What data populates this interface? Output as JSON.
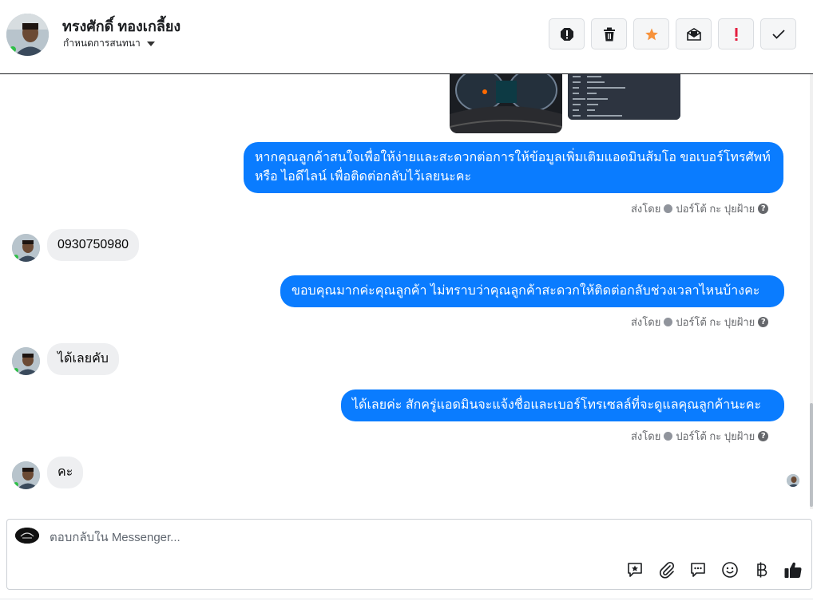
{
  "header": {
    "contact_name": "ทรงศักดิ์ ทองเกลี้ยง",
    "assign_label": "กำหนดการสนทนา",
    "toolbar": [
      {
        "icon": "stop-icon",
        "color": "#1c1e21"
      },
      {
        "icon": "trash-icon",
        "color": "#1c1e21"
      },
      {
        "icon": "star-icon",
        "color": "#f7923b"
      },
      {
        "icon": "mark-unread-icon",
        "color": "#1c1e21"
      },
      {
        "icon": "exclamation-icon",
        "color": "#e41e3f"
      },
      {
        "icon": "check-icon",
        "color": "#1c1e21"
      }
    ]
  },
  "thread": {
    "messages": [
      {
        "direction": "out",
        "text": "หากคุณลูกค้าสนใจเพื่อให้ง่ายและสะดวกต่อการให้ข้อมูลเพิ่มเติมแอดมินส้มโอ ขอเบอร์โทรศัพท์ หรือ ไอดีไลน์ เพื่อติดต่อกลับไว้เลยนะคะ",
        "sent_by_label": "ส่งโดย",
        "sender": "ปอร์โต้ กะ ปุยฝ้าย"
      },
      {
        "direction": "in",
        "text": "0930750980"
      },
      {
        "direction": "out",
        "text": "ขอบคุณมากค่ะคุณลูกค้า ไม่ทราบว่าคุณลูกค้าสะดวกให้ติดต่อกลับช่วงเวลาไหนบ้างคะ",
        "sent_by_label": "ส่งโดย",
        "sender": "ปอร์โต้ กะ ปุยฝ้าย"
      },
      {
        "direction": "in",
        "text": "ได้เลยคับ"
      },
      {
        "direction": "out",
        "text": "ได้เลยค่ะ สักครู่แอดมินจะแจ้งชื่อและเบอร์โทรเซลล์ที่จะดูแลคุณลูกค้านะคะ",
        "sent_by_label": "ส่งโดย",
        "sender": "ปอร์โต้ กะ ปุยฝ้าย"
      },
      {
        "direction": "in",
        "text": "คะ"
      }
    ]
  },
  "composer": {
    "placeholder": "ตอบกลับใน Messenger...",
    "tools": [
      "saved-reply-icon",
      "attachment-icon",
      "chat-icon",
      "emoji-icon",
      "baht-icon",
      "thumbs-up-icon"
    ]
  },
  "colors": {
    "outgoing_bubble": "#0a7cff",
    "incoming_bubble": "#eeeff1"
  }
}
